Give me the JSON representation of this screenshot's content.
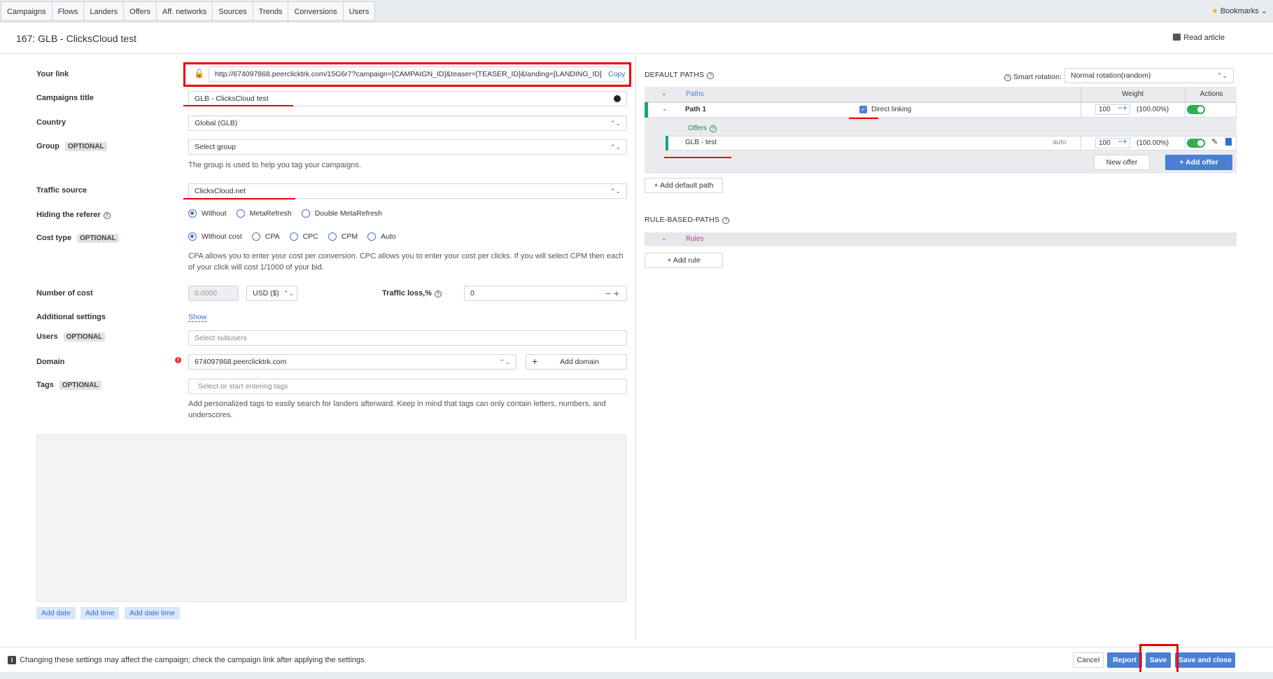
{
  "nav": {
    "tabs": [
      "Campaigns",
      "Flows",
      "Landers",
      "Offers",
      "Aff. networks",
      "Sources",
      "Trends",
      "Conversions",
      "Users"
    ],
    "bookmarks": "Bookmarks"
  },
  "header": {
    "title": "167: GLB - ClicksCloud test",
    "read_article": "Read article"
  },
  "form": {
    "your_link": {
      "label": "Your link",
      "value": "http://674097868.peerclicktrk.com/15G6r7?campaign=[CAMPAIGN_ID]&teaser=[TEASER_ID]&landing=[LANDING_ID]",
      "copy": "Copy"
    },
    "campaign_title": {
      "label": "Campaigns title",
      "value": "GLB - ClicksCloud test"
    },
    "country": {
      "label": "Country",
      "value": "Global (GLB)"
    },
    "group": {
      "label": "Group",
      "optional": "OPTIONAL",
      "placeholder": "Select group",
      "hint": "The group is used to help you tag your campaigns."
    },
    "traffic_source": {
      "label": "Traffic source",
      "value": "ClicksCloud.net"
    },
    "hiding_referer": {
      "label": "Hiding the referer",
      "options": [
        "Without",
        "MetaRefresh",
        "Double MetaRefresh"
      ],
      "selected": "Without"
    },
    "cost_type": {
      "label": "Cost type",
      "optional": "OPTIONAL",
      "options": [
        "Without cost",
        "CPA",
        "CPC",
        "CPM",
        "Auto"
      ],
      "selected": "Without cost",
      "hint_line1": "CPA allows you to enter your cost per conversion. CPC allows you to enter your cost per clicks. If you will select CPM then each",
      "hint_line2": "of your click will cost 1/1000 of your bid."
    },
    "number_of_cost": {
      "label": "Number of cost",
      "placeholder": "0.0000",
      "currency": "USD ($)"
    },
    "traffic_loss": {
      "label": "Traffic loss,%",
      "value": "0"
    },
    "additional_settings": {
      "label": "Additional settings",
      "link": "Show"
    },
    "users": {
      "label": "Users",
      "optional": "OPTIONAL",
      "placeholder": "Select subusers"
    },
    "domain": {
      "label": "Domain",
      "value": "674097868.peerclicktrk.com",
      "add_domain": "Add domain"
    },
    "tags": {
      "label": "Tags",
      "optional": "OPTIONAL",
      "placeholder": "Select or start entering tags",
      "hint_line1": "Add personalized tags to easily search for landers afterward. Keep in mind that tags can only contain letters, numbers, and",
      "hint_line2": "underscores."
    },
    "chips": [
      "Add date",
      "Add time",
      "Add date time"
    ]
  },
  "paths": {
    "default_title": "DEFAULT PATHS",
    "smart_rotation_label": "Smart rotation:",
    "smart_rotation_value": "Normal rotation(random)",
    "col_paths": "Paths",
    "col_weight": "Weight",
    "col_actions": "Actions",
    "path1": {
      "name": "Path 1",
      "direct_linking": "Direct linking",
      "weight": "100",
      "pct": "(100.00%)"
    },
    "offers_label": "Offers",
    "offer1": {
      "name": "GLB - test",
      "mode": "auto",
      "weight": "100",
      "pct": "(100.00%)"
    },
    "new_offer": "New offer",
    "add_offer": "Add offer",
    "add_default_path": "Add default path",
    "rule_title": "RULE-BASED-PATHS",
    "rules": "Rules",
    "add_rule": "Add rule"
  },
  "footer": {
    "message": "Changing these settings may affect the campaign; check the campaign link after applying the settings.",
    "cancel": "Cancel",
    "report": "Report",
    "save": "Save",
    "save_close": "Save and close"
  },
  "colors": {
    "accent": "#4a7fd4",
    "annotation_red": "#e00000",
    "toggle_green": "#2fae54",
    "path_marker": "#1aa37a"
  }
}
